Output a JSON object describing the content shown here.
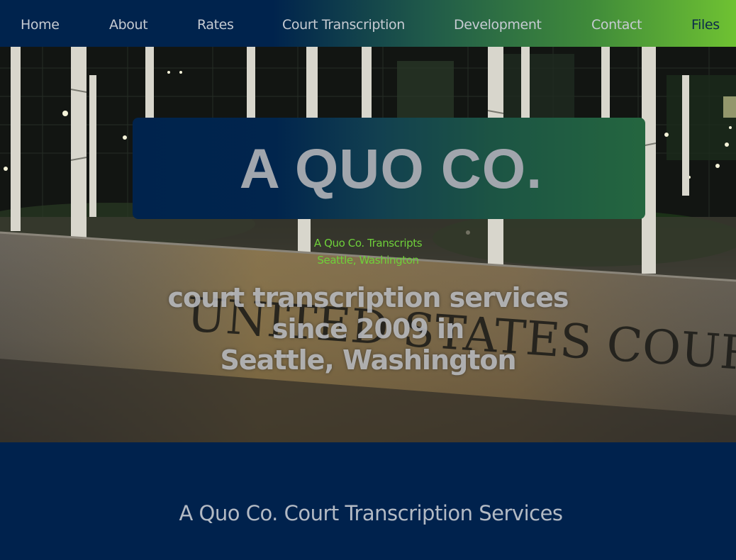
{
  "nav": {
    "items": [
      {
        "label": "Home"
      },
      {
        "label": "About"
      },
      {
        "label": "Rates"
      },
      {
        "label": "Court Transcription"
      },
      {
        "label": "Development"
      },
      {
        "label": "Contact"
      },
      {
        "label": "Files"
      }
    ]
  },
  "hero": {
    "title": "A QUO CO.",
    "subtitle_line1": "A Quo Co. Transcripts",
    "subtitle_line2": "Seattle, Washington",
    "tagline_line1": "court transcription services",
    "tagline_line2": "since 2009 in",
    "tagline_line3": "Seattle, Washington",
    "background_image_text": "UNITED STATES COURTHOUSE"
  },
  "section": {
    "heading": "A Quo Co. Court Transcription Services"
  },
  "colors": {
    "navy": "#00224d",
    "green_accent": "#6fc232",
    "nav_text": "#c6cbd2",
    "title_text": "#a1a6ad"
  }
}
